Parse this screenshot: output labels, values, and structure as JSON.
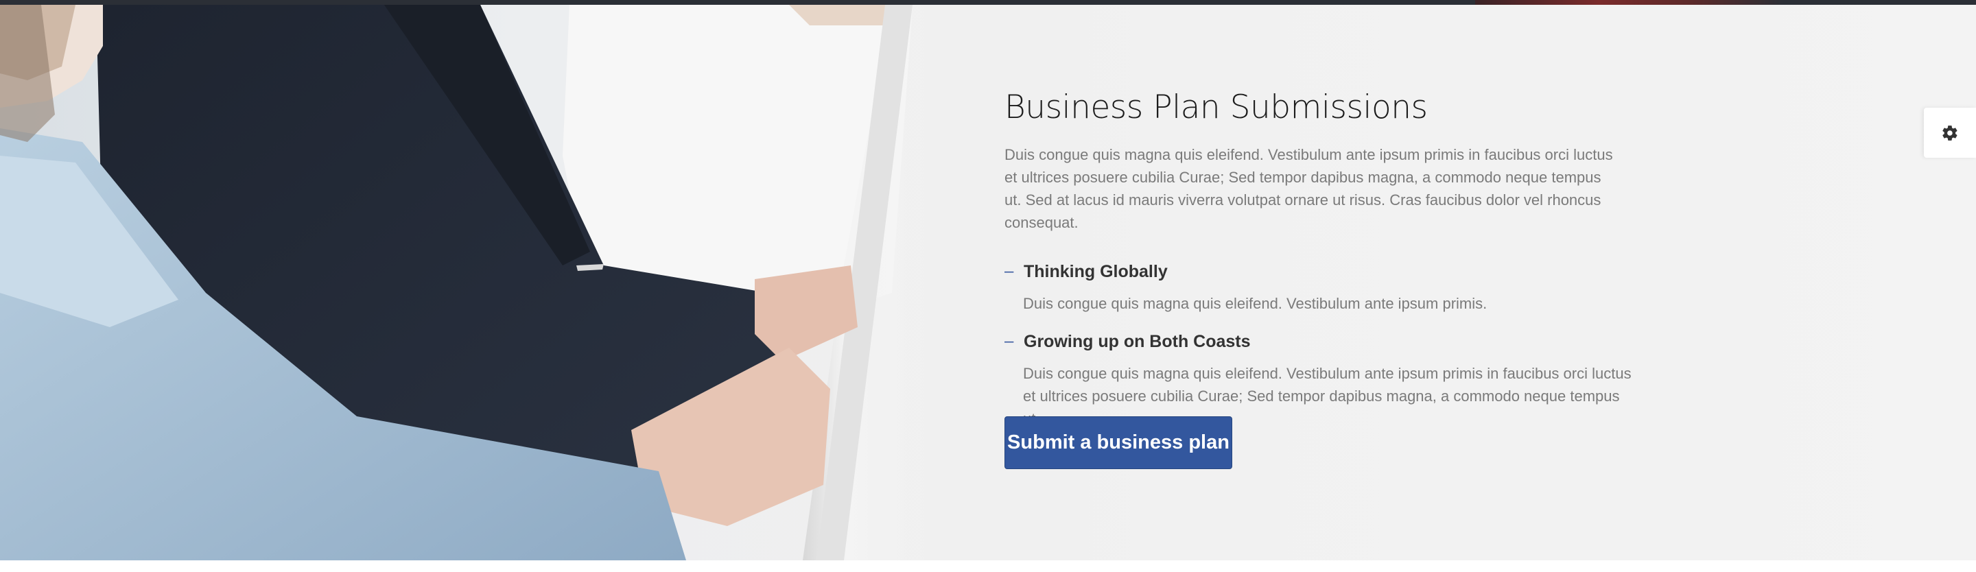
{
  "section": {
    "title": "Business Plan Submissions",
    "lead": "Duis congue quis magna quis eleifend. Vestibulum ante ipsum primis in faucibus orci luctus et ultrices posuere cubilia Curae; Sed tempor dapibus magna, a commodo neque tempus ut. Sed at lacus id mauris viverra volutpat ornare ut risus. Cras faucibus dolor vel rhoncus consequat.",
    "features": [
      {
        "dash": "–",
        "title": "Thinking Globally",
        "text": "Duis congue quis magna quis eleifend. Vestibulum ante ipsum primis."
      },
      {
        "dash": "–",
        "title": "Growing up on Both Coasts",
        "text": "Duis congue quis magna quis eleifend. Vestibulum ante ipsum primis in faucibus orci luctus et ultrices posuere cubilia Curae; Sed tempor dapibus magna, a commodo neque tempus ut."
      }
    ],
    "cta_label": "Submit a business plan"
  },
  "settings": {
    "icon": "gear-icon"
  },
  "colors": {
    "accent": "#33579e",
    "title": "#1c1c1c",
    "body_text": "#7a7a7a",
    "topbar": "#2b2f36"
  }
}
